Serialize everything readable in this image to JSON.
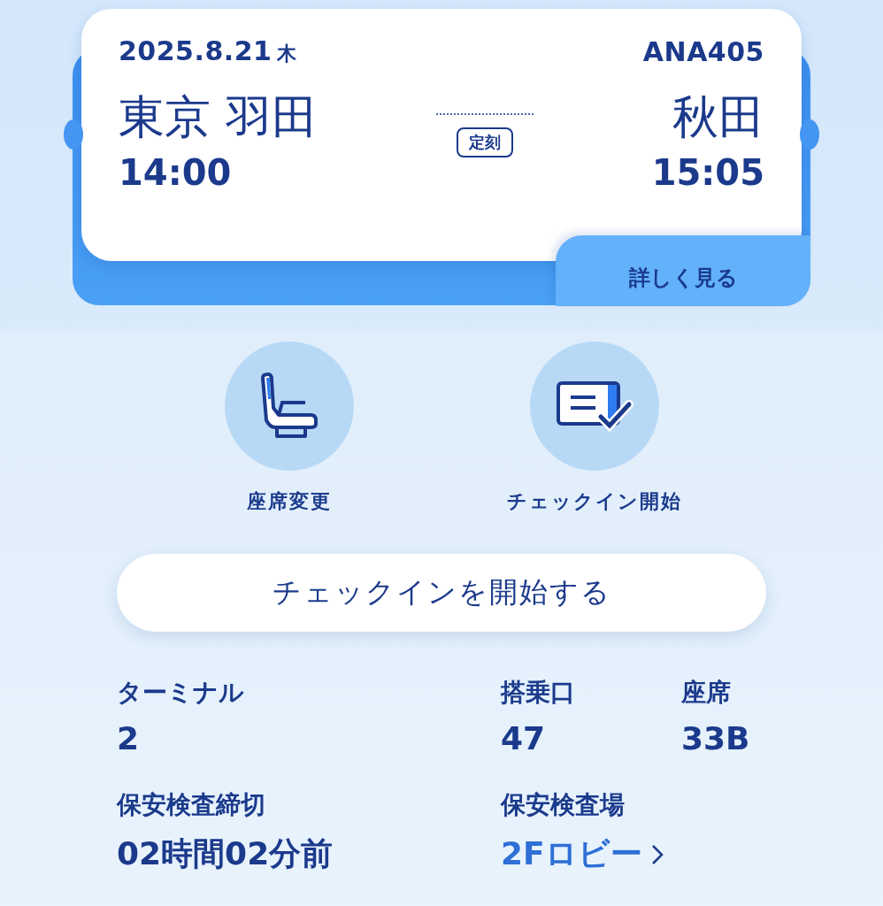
{
  "flight": {
    "date": "2025.8.21",
    "weekday": "木",
    "number": "ANA405",
    "origin": "東京 羽田",
    "destination": "秋田",
    "status": "定刻",
    "departure": "14:00",
    "arrival": "15:05",
    "details_link": "詳しく見る"
  },
  "actions": [
    {
      "kind": "seat",
      "label": "座席変更"
    },
    {
      "kind": "checkin",
      "label": "チェックイン開始"
    }
  ],
  "primary_button": "チェックインを開始する",
  "info": [
    [
      {
        "kind": "text",
        "label": "ターミナル",
        "value": "2"
      },
      {
        "kind": "text",
        "label": "搭乗口",
        "value": "47"
      },
      {
        "kind": "text",
        "label": "座席",
        "value": "33B"
      }
    ],
    [
      {
        "kind": "text",
        "label": "保安検査締切",
        "value": "02時間02分前"
      },
      {
        "kind": "link",
        "label": "保安検査場",
        "value": "2Fロビー"
      }
    ]
  ]
}
